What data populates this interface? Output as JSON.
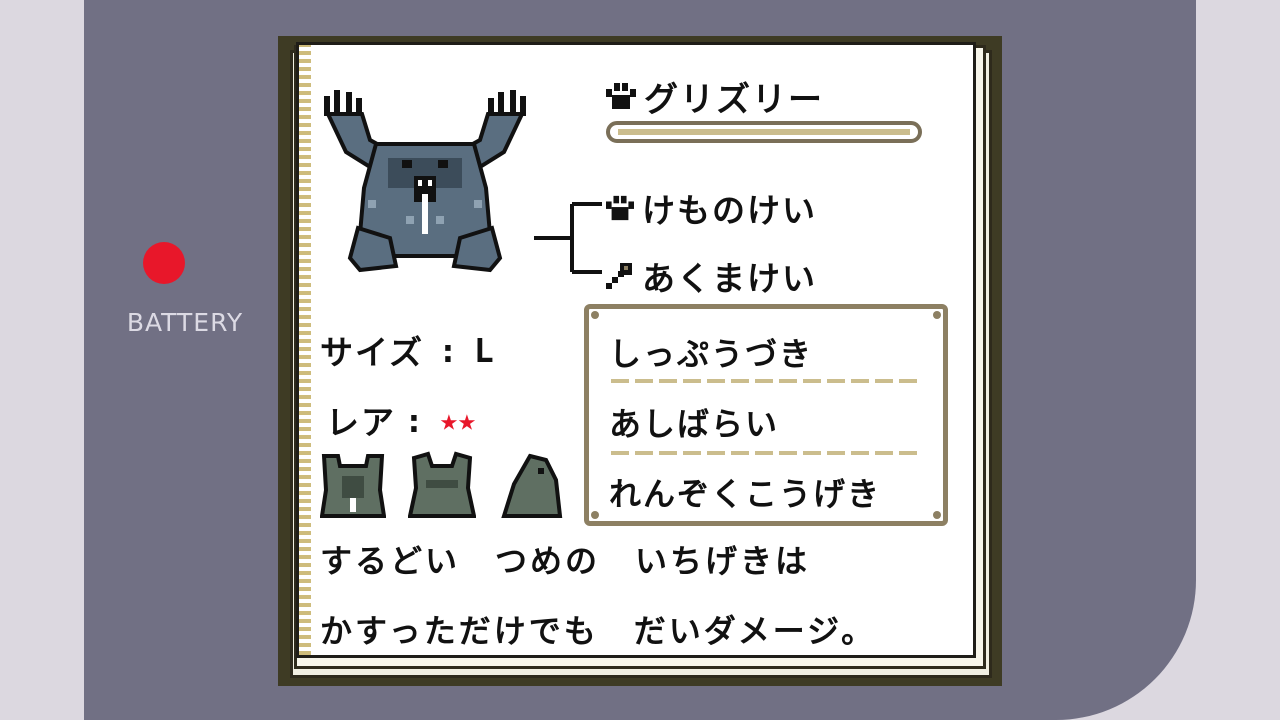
{
  "device": {
    "battery_label": "BATTERY",
    "led_color": "#e8172a"
  },
  "entry": {
    "name": "グリズリー",
    "name_icon": "paw-icon",
    "families": [
      {
        "icon": "paw-icon",
        "label": "けものけい"
      },
      {
        "icon": "axe-icon",
        "label": "あくまけい"
      }
    ],
    "size_label": "サイズ",
    "size_value": "L",
    "rarity_label": "レア",
    "rarity_stars": "★★",
    "thumbnails": [
      "bear-front-thumbnail",
      "frog-front-thumbnail",
      "creature-side-thumbnail"
    ],
    "moves": [
      "しっぷうづき",
      "あしばらい",
      "れんぞくこうげき"
    ],
    "description": [
      "するどい　つめの　いちげきは",
      "かすっただけでも　だいダメージ。"
    ]
  },
  "colors": {
    "screen_frame": "#3e3b24",
    "page": "#ffffff",
    "accent_tan": "#cbbd8d",
    "frame_brown": "#8d8063",
    "star_red": "#e8172a",
    "monster_blue": "#5a6e80"
  }
}
